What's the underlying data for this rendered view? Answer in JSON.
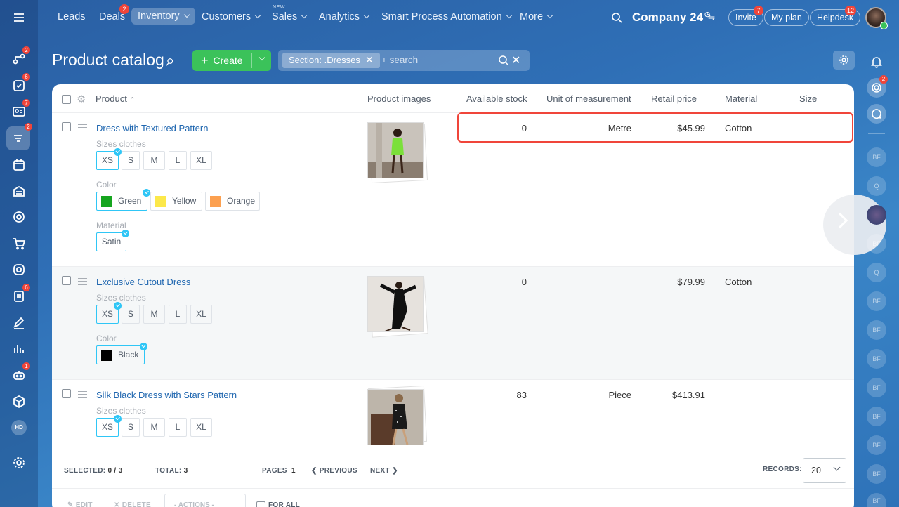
{
  "topnav": {
    "items": [
      {
        "label": "Leads"
      },
      {
        "label": "Deals",
        "badge": "2"
      },
      {
        "label": "Inventory"
      },
      {
        "label": "Customers"
      },
      {
        "label": "Sales",
        "tag": "NEW"
      },
      {
        "label": "Analytics"
      },
      {
        "label": "Smart Process Automation"
      },
      {
        "label": "More"
      }
    ],
    "company": "Company 24",
    "invite": "Invite",
    "invite_badge": "7",
    "my_plan": "My plan",
    "helpdesk": "Helpdesk",
    "helpdesk_badge": "12"
  },
  "leftbar": {
    "badges": {
      "b1": "2",
      "b2": "6",
      "b3": "7",
      "b4": "2",
      "b5": "6",
      "b6": "1"
    },
    "avatar_initials": "HD"
  },
  "header": {
    "title": "Product catalog",
    "create_label": "Create",
    "filter_chip": "Section: .Dresses",
    "search_placeholder": "+ search"
  },
  "table": {
    "columns": {
      "product": "Product",
      "images": "Product images",
      "stock": "Available stock",
      "unit": "Unit of measurement",
      "price": "Retail price",
      "material": "Material",
      "size": "Size"
    },
    "rows": [
      {
        "name": "Dress with Textured Pattern",
        "stock": "0",
        "unit": "Metre",
        "price": "$45.99",
        "material": "Cotton",
        "sizes_label": "Sizes clothes",
        "sizes": [
          "XS",
          "S",
          "M",
          "L",
          "XL"
        ],
        "color_label": "Color",
        "colors": [
          {
            "name": "Green",
            "hex": "#16a51f"
          },
          {
            "name": "Yellow",
            "hex": "#fce84a"
          },
          {
            "name": "Orange",
            "hex": "#fca050"
          }
        ],
        "material_label": "Material",
        "materials": [
          "Satin"
        ]
      },
      {
        "name": "Exclusive Cutout Dress",
        "stock": "0",
        "unit": "",
        "price": "$79.99",
        "material": "Cotton",
        "sizes_label": "Sizes clothes",
        "sizes": [
          "XS",
          "S",
          "M",
          "L",
          "XL"
        ],
        "color_label": "Color",
        "colors": [
          {
            "name": "Black",
            "hex": "#000000"
          }
        ]
      },
      {
        "name": "Silk Black Dress with Stars Pattern",
        "stock": "83",
        "unit": "Piece",
        "price": "$413.91",
        "material": "",
        "sizes_label": "Sizes clothes",
        "sizes": [
          "XS",
          "S",
          "M",
          "L",
          "XL"
        ]
      }
    ]
  },
  "footer": {
    "selected_label": "SELECTED:",
    "selected_value": "0 / 3",
    "total_label": "TOTAL:",
    "total_value": "3",
    "pages_label": "PAGES",
    "pages_value": "1",
    "previous": "PREVIOUS",
    "next": "NEXT",
    "records_label": "RECORDS:",
    "records_value": "20",
    "edit": "EDIT",
    "delete": "DELETE",
    "actions": "- ACTIONS -",
    "for_all": "FOR ALL"
  },
  "rightbar": {
    "badge": "2",
    "initials": [
      "BF",
      "Q",
      "BF",
      "Q",
      "BF",
      "BF",
      "BF",
      "BF",
      "BF",
      "BF",
      "BF",
      "BF"
    ]
  },
  "colors": {
    "accent": "#2fc6f6",
    "create": "#3bc25a",
    "highlight": "#f0453a",
    "link": "#2067b0"
  }
}
